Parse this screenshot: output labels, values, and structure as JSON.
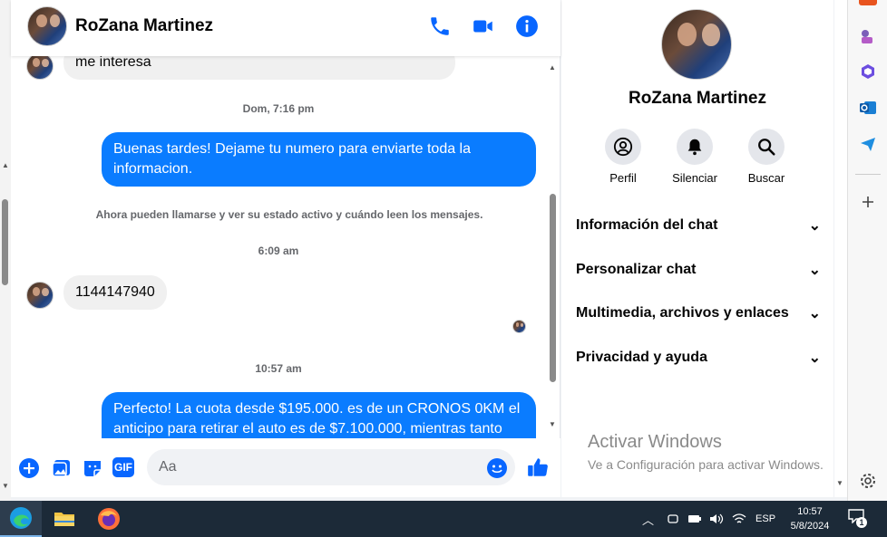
{
  "header": {
    "contact_name": "RoZana Martinez",
    "icons": [
      "phone-icon",
      "video-icon",
      "info-icon"
    ]
  },
  "messages": {
    "top_partial": "me interesa",
    "ts1": "Dom, 7:16 pm",
    "out1": "Buenas tardes! Dejame tu numero para enviarte toda la informacion.",
    "system_notice": "Ahora pueden llamarse y ver su estado activo y cuándo leen los mensajes.",
    "ts2": "6:09 am",
    "in1": "1144147940",
    "ts3": "10:57 am",
    "out2": "Perfecto! La cuota desde $195.000. es de un CRONOS 0KM el anticipo para retirar el auto es de $7.100.000, mientras tanto"
  },
  "composer": {
    "placeholder": "Aa",
    "icons": [
      "plus-circle-icon",
      "image-icon",
      "sticker-icon",
      "gif-icon",
      "emoji-icon",
      "like-icon"
    ],
    "gif_label": "GIF"
  },
  "info_panel": {
    "name": "RoZana Martinez",
    "actions": [
      {
        "label": "Perfil",
        "icon": "profile-icon"
      },
      {
        "label": "Silenciar",
        "icon": "bell-icon"
      },
      {
        "label": "Buscar",
        "icon": "search-icon"
      }
    ],
    "sections": [
      "Información del chat",
      "Personalizar chat",
      "Multimedia, archivos y enlaces",
      "Privacidad y ayuda"
    ]
  },
  "watermark": {
    "line1": "Activar Windows",
    "line2": "Ve a Configuración para activar Windows."
  },
  "taskbar": {
    "apps": [
      "edge-icon",
      "file-explorer-icon",
      "firefox-icon"
    ],
    "lang": "ESP",
    "time": "10:57",
    "date": "5/8/2024",
    "notifications": "1"
  },
  "colors": {
    "accent": "#0a7cff",
    "icon_blue": "#0866ff",
    "taskbar": "#1c2a38"
  }
}
